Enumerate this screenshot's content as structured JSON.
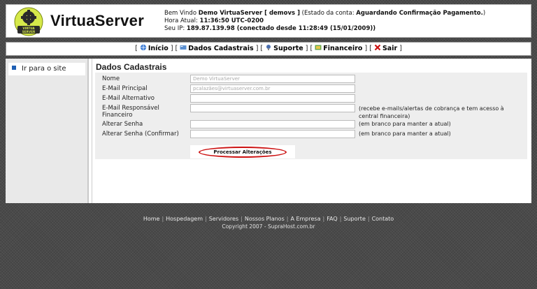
{
  "header": {
    "logo_text": "VIRTUA SERVER",
    "brand": "VirtuaServer",
    "welcome_prefix": "Bem Vindo ",
    "welcome_user": "Demo VirtuaServer [ demovs ]",
    "status_prefix": " (Estado da conta: ",
    "status_value": "Aguardando Confirmação Pagamento.",
    "status_suffix": ")",
    "time_label": "Hora Atual: ",
    "time_value": "11:36:50 UTC-0200",
    "ip_label": "Seu IP: ",
    "ip_value": "189.87.139.98 (conectado desde 11:28:49 (15/01/2009))"
  },
  "nav": {
    "items": [
      {
        "label": "Início",
        "icon": "globe-icon",
        "color": "#3a7bd5"
      },
      {
        "label": "Dados Cadastrais",
        "icon": "card-icon",
        "color": "#5a8fd0"
      },
      {
        "label": "Suporte",
        "icon": "support-icon",
        "color": "#4a6fb0"
      },
      {
        "label": "Financeiro",
        "icon": "money-icon",
        "color": "#6aa84f"
      },
      {
        "label": "Sair",
        "icon": "close-icon",
        "color": "#cc1111"
      }
    ]
  },
  "sidebar": {
    "items": [
      {
        "label": "Ir para o site"
      }
    ]
  },
  "main": {
    "title": "Dados Cadastrais",
    "fields": [
      {
        "label": "Nome",
        "value": "Demo VirtuaServer",
        "note": ""
      },
      {
        "label": "E-Mail Principal",
        "value": "pcalazães@virtuaserver.com.br",
        "note": ""
      },
      {
        "label": "E-Mail Alternativo",
        "value": "",
        "note": ""
      },
      {
        "label": "E-Mail Responsável Financeiro",
        "value": "",
        "note": "(recebe e-mails/alertas de cobrança e tem acesso à central financeira)"
      },
      {
        "label": "Alterar Senha",
        "value": "",
        "note": "(em branco para manter a atual)"
      },
      {
        "label": "Alterar Senha (Confirmar)",
        "value": "",
        "note": "(em branco para manter a atual)"
      }
    ],
    "submit_label": "Processar Alterações"
  },
  "footer": {
    "links": [
      "Home",
      "Hospedagem",
      "Servidores",
      "Nossos Planos",
      "A Empresa",
      "FAQ",
      "Suporte",
      "Contato"
    ],
    "copyright": "Copyright 2007 - SupraHost.com.br"
  }
}
